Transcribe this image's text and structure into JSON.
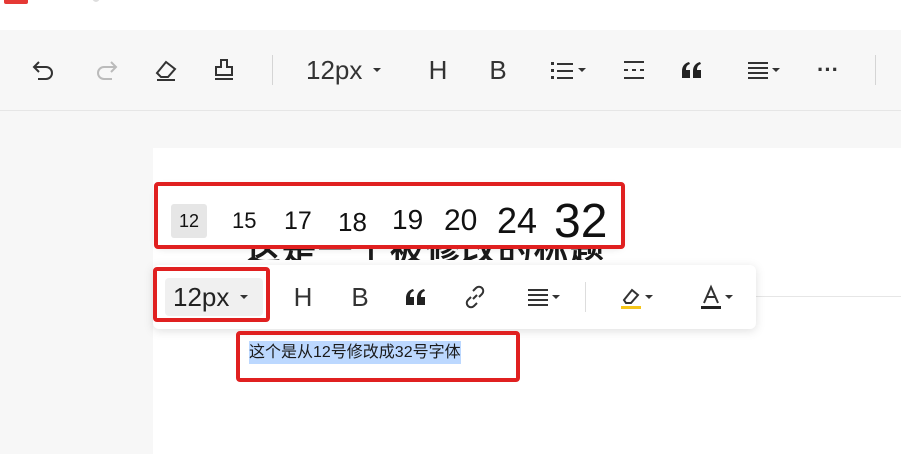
{
  "toolbar": {
    "font_size_value": "12px",
    "heading_label": "H",
    "bold_label": "B",
    "more_label": "···"
  },
  "editor": {
    "heading_ghost": "这是一个被修改的标题",
    "selected_text": "这个是从12号修改成32号字体"
  },
  "size_popup": {
    "options": [
      "12",
      "15",
      "17",
      "18",
      "19",
      "20",
      "24",
      "32"
    ],
    "selected": "12"
  },
  "float_toolbar": {
    "font_size_value": "12px",
    "heading_label": "H",
    "bold_label": "B"
  },
  "colors": {
    "annotation_red": "#e02020",
    "selection_blue": "#bcd8ff",
    "highlight_yellow": "#f5c518"
  }
}
